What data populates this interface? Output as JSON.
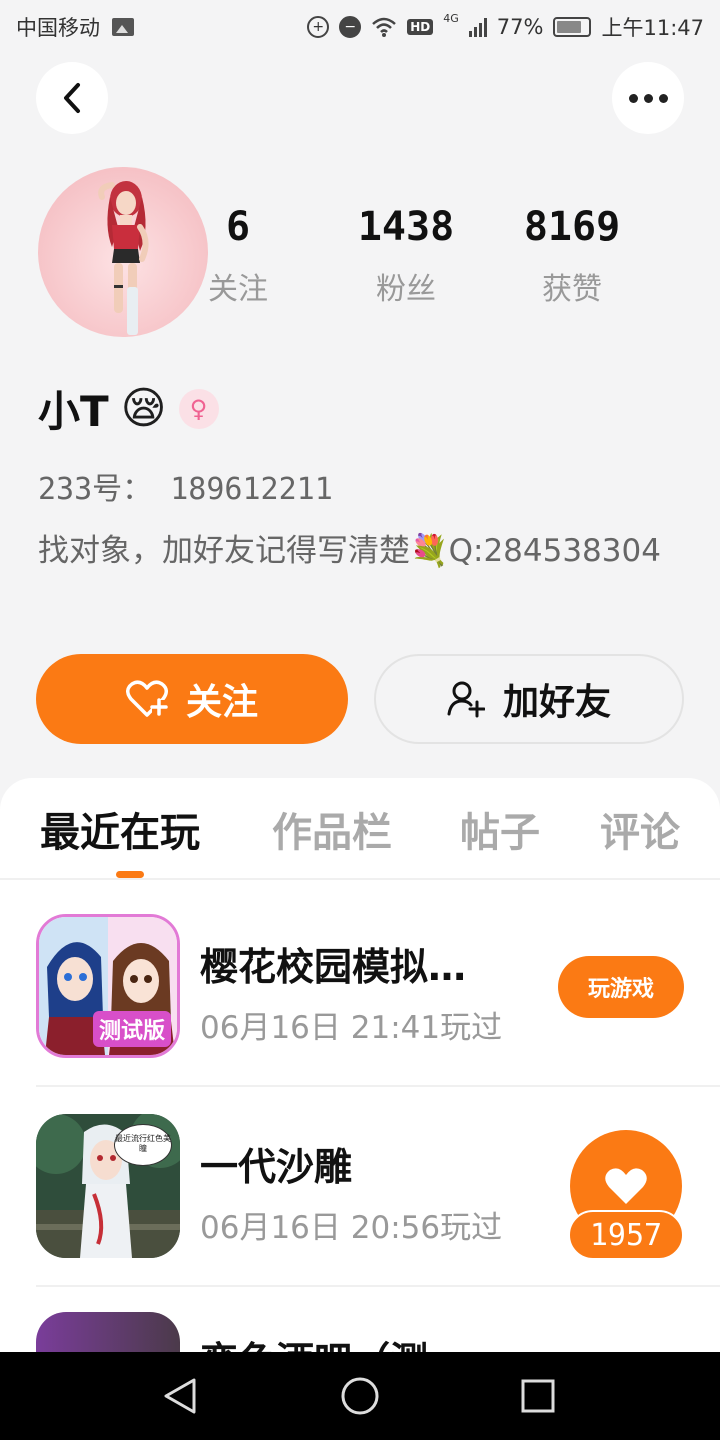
{
  "status_bar": {
    "carrier": "中国移动",
    "network": "4G",
    "battery": "77%",
    "time": "上午11:47",
    "hd_label": "HD"
  },
  "profile": {
    "stats": [
      {
        "value": "6",
        "label": "关注"
      },
      {
        "value": "1438",
        "label": "粉丝"
      },
      {
        "value": "8169",
        "label": "获赞"
      }
    ],
    "name": "小T",
    "name_emoji": "😪",
    "gender_icon": "♀",
    "id_line": "233号： 189612211",
    "bio": "找对象，加好友记得写清楚💐Q:284538304"
  },
  "actions": {
    "follow_label": "关注",
    "add_friend_label": "加好友"
  },
  "tabs": [
    "最近在玩",
    "作品栏",
    "帖子",
    "评论"
  ],
  "games": [
    {
      "title": "樱花校园模拟…",
      "played": "06月16日 21:41玩过",
      "badge": "测试版",
      "action": "玩游戏"
    },
    {
      "title": "一代沙雕",
      "played": "06月16日 20:56玩过",
      "bubble": "最近流行红色美瞳"
    },
    {
      "title": "变色酒吧（测",
      "played": ""
    }
  ],
  "like_float": {
    "count": "1957"
  },
  "colors": {
    "accent": "#fb7a14",
    "background": "#f4f4f5"
  }
}
